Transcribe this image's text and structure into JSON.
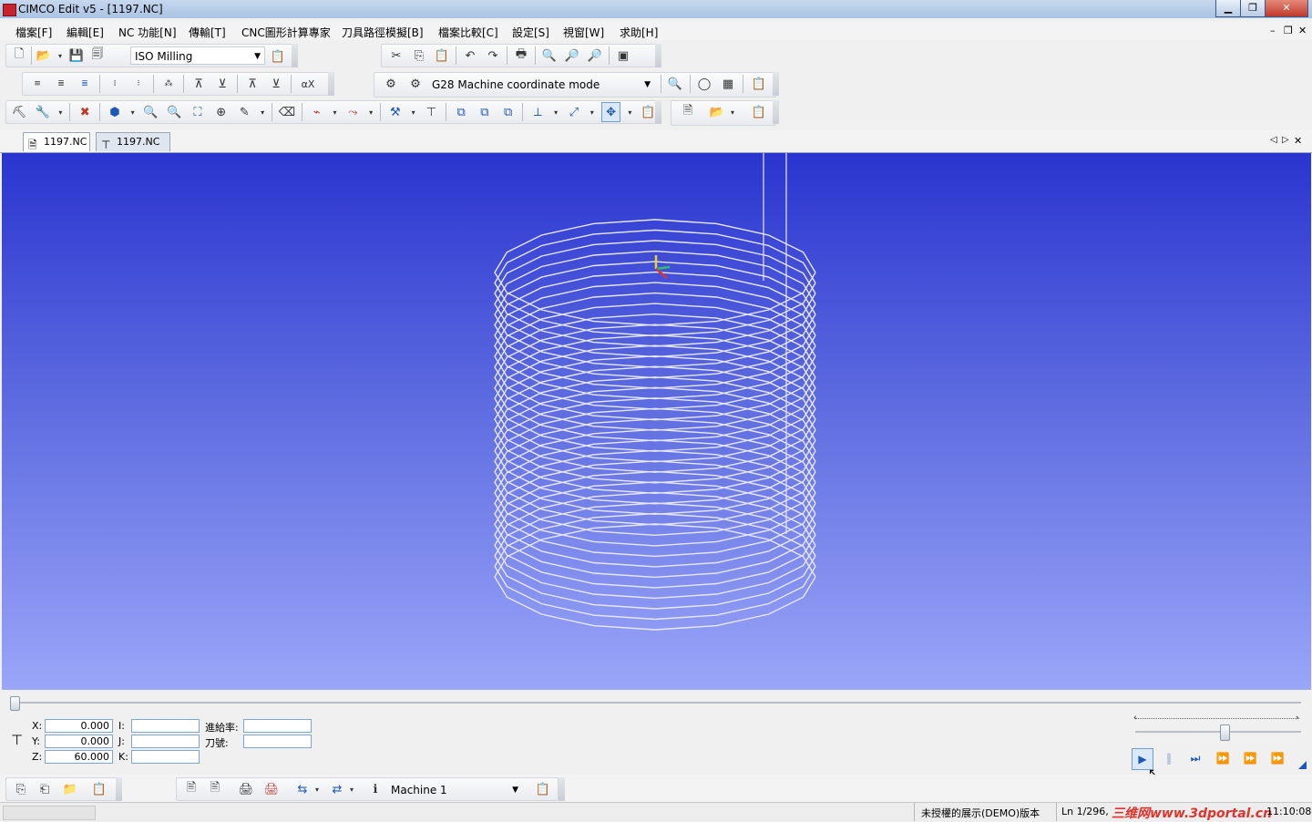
{
  "window": {
    "title": "CIMCO Edit v5 - [1197.NC]",
    "minimize": "▁",
    "maximize": "❐",
    "close": "✕"
  },
  "menu": [
    "檔案[F]",
    "編輯[E]",
    "NC 功能[N]",
    "傳輸[T]",
    "CNC圖形計算專家",
    "刀具路徑模擬[B]",
    "檔案比較[C]",
    "設定[S]",
    "視窗[W]",
    "求助[H]"
  ],
  "mdi_controls": {
    "minimize": "–",
    "restore": "❐",
    "close": "✕"
  },
  "toolbar1": {
    "machine_type": "ISO Milling"
  },
  "toolbar2": {
    "coordinate_mode": "G28 Machine coordinate mode",
    "x_label": "αX"
  },
  "tabs": [
    {
      "label": "1197.NC",
      "icon": "nc-file-icon"
    },
    {
      "label": "1197.NC",
      "icon": "backplot-icon"
    }
  ],
  "tab_nav": {
    "prev": "◁",
    "next": "▷",
    "close": "✕"
  },
  "backplot": {
    "coordinates": {
      "X": "0.000",
      "Y": "0.000",
      "Z": "60.000",
      "I": "",
      "J": "",
      "K": ""
    },
    "labels": {
      "X": "X:",
      "Y": "Y:",
      "Z": "Z:",
      "I": "I:",
      "J": "J:",
      "K": "K:",
      "feed": "進給率:",
      "tool": "刀號:"
    },
    "feed_rate": "",
    "tool_number": "",
    "progress": 0,
    "speed_level": 0.55
  },
  "bottom_toolbar": {
    "machine": "Machine 1"
  },
  "status": {
    "demo": "未授權的展示(DEMO)版本",
    "line": "Ln 1/296,",
    "watermark": "三维网www.3dportal.cn",
    "time": "11:10:08"
  },
  "colors": {
    "viewport_top": "#2a35cf",
    "viewport_bottom": "#9aa6f8",
    "toolpath": "#e8e8f4",
    "accent": "#1d58b8"
  }
}
